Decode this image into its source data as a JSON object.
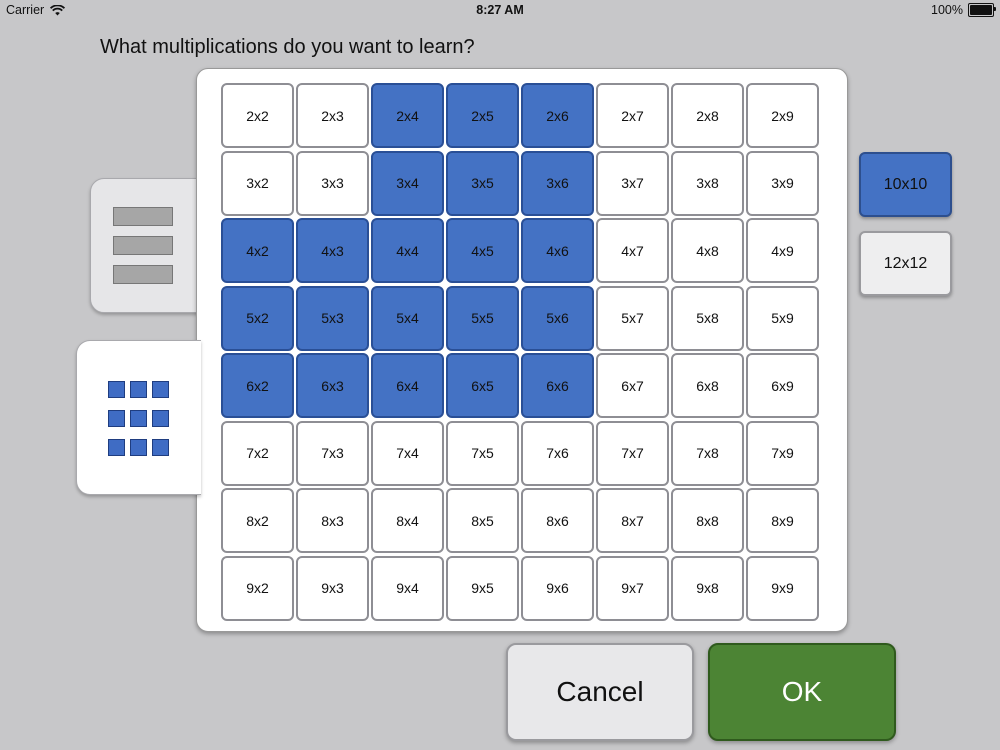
{
  "status_bar": {
    "carrier": "Carrier",
    "time": "8:27 AM",
    "battery": "100%",
    "wifi_icon": "wifi-icon",
    "battery_icon": "battery-icon",
    "battery_level": 1.0
  },
  "title": "What multiplications do you want to learn?",
  "tabs": [
    {
      "icon": "list-icon",
      "active": false
    },
    {
      "icon": "grid-icon",
      "active": true
    }
  ],
  "grid": {
    "rows": [
      [
        {
          "label": "2x2",
          "selected": false
        },
        {
          "label": "2x3",
          "selected": false
        },
        {
          "label": "2x4",
          "selected": true
        },
        {
          "label": "2x5",
          "selected": true
        },
        {
          "label": "2x6",
          "selected": true
        },
        {
          "label": "2x7",
          "selected": false
        },
        {
          "label": "2x8",
          "selected": false
        },
        {
          "label": "2x9",
          "selected": false
        }
      ],
      [
        {
          "label": "3x2",
          "selected": false
        },
        {
          "label": "3x3",
          "selected": false
        },
        {
          "label": "3x4",
          "selected": true
        },
        {
          "label": "3x5",
          "selected": true
        },
        {
          "label": "3x6",
          "selected": true
        },
        {
          "label": "3x7",
          "selected": false
        },
        {
          "label": "3x8",
          "selected": false
        },
        {
          "label": "3x9",
          "selected": false
        }
      ],
      [
        {
          "label": "4x2",
          "selected": true
        },
        {
          "label": "4x3",
          "selected": true
        },
        {
          "label": "4x4",
          "selected": true
        },
        {
          "label": "4x5",
          "selected": true
        },
        {
          "label": "4x6",
          "selected": true
        },
        {
          "label": "4x7",
          "selected": false
        },
        {
          "label": "4x8",
          "selected": false
        },
        {
          "label": "4x9",
          "selected": false
        }
      ],
      [
        {
          "label": "5x2",
          "selected": true
        },
        {
          "label": "5x3",
          "selected": true
        },
        {
          "label": "5x4",
          "selected": true
        },
        {
          "label": "5x5",
          "selected": true
        },
        {
          "label": "5x6",
          "selected": true
        },
        {
          "label": "5x7",
          "selected": false
        },
        {
          "label": "5x8",
          "selected": false
        },
        {
          "label": "5x9",
          "selected": false
        }
      ],
      [
        {
          "label": "6x2",
          "selected": true
        },
        {
          "label": "6x3",
          "selected": true
        },
        {
          "label": "6x4",
          "selected": true
        },
        {
          "label": "6x5",
          "selected": true
        },
        {
          "label": "6x6",
          "selected": true
        },
        {
          "label": "6x7",
          "selected": false
        },
        {
          "label": "6x8",
          "selected": false
        },
        {
          "label": "6x9",
          "selected": false
        }
      ],
      [
        {
          "label": "7x2",
          "selected": false
        },
        {
          "label": "7x3",
          "selected": false
        },
        {
          "label": "7x4",
          "selected": false
        },
        {
          "label": "7x5",
          "selected": false
        },
        {
          "label": "7x6",
          "selected": false
        },
        {
          "label": "7x7",
          "selected": false
        },
        {
          "label": "7x8",
          "selected": false
        },
        {
          "label": "7x9",
          "selected": false
        }
      ],
      [
        {
          "label": "8x2",
          "selected": false
        },
        {
          "label": "8x3",
          "selected": false
        },
        {
          "label": "8x4",
          "selected": false
        },
        {
          "label": "8x5",
          "selected": false
        },
        {
          "label": "8x6",
          "selected": false
        },
        {
          "label": "8x7",
          "selected": false
        },
        {
          "label": "8x8",
          "selected": false
        },
        {
          "label": "8x9",
          "selected": false
        }
      ],
      [
        {
          "label": "9x2",
          "selected": false
        },
        {
          "label": "9x3",
          "selected": false
        },
        {
          "label": "9x4",
          "selected": false
        },
        {
          "label": "9x5",
          "selected": false
        },
        {
          "label": "9x6",
          "selected": false
        },
        {
          "label": "9x7",
          "selected": false
        },
        {
          "label": "9x8",
          "selected": false
        },
        {
          "label": "9x9",
          "selected": false
        }
      ]
    ]
  },
  "size_options": [
    {
      "label": "10x10",
      "selected": true
    },
    {
      "label": "12x12",
      "selected": false
    }
  ],
  "buttons": {
    "cancel": "Cancel",
    "ok": "OK"
  },
  "colors": {
    "selected": "#4472c4",
    "ok": "#4c8434",
    "background": "#c7c7c9"
  }
}
